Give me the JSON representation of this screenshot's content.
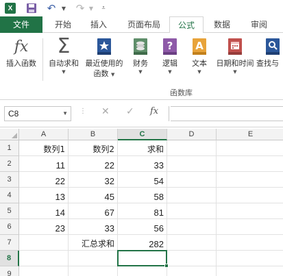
{
  "qat": {
    "logo_text": "X"
  },
  "tabs": {
    "file": "文件",
    "home": "开始",
    "insert": "插入",
    "page_layout": "页面布局",
    "formulas": "公式",
    "data": "数据",
    "review": "审阅"
  },
  "ribbon": {
    "insert_function": "插入函数",
    "autosum": "自动求和",
    "recently_used_line1": "最近使用的",
    "recently_used_line2": "函数",
    "financial": "财务",
    "logical": "逻辑",
    "text": "文本",
    "date_time": "日期和时间",
    "lookup": "查找与",
    "group_label": "函数库",
    "icons": [
      "fx-icon",
      "sigma-icon",
      "star-book-icon",
      "coins-book-icon",
      "question-book-icon",
      "text-book-icon",
      "calendar-book-icon",
      "lookup-book-icon"
    ],
    "colors": {
      "brand": "#217346",
      "blue_book": "#2b579a",
      "finance": "#5f8e6a",
      "logic": "#8e5aa8",
      "text_book": "#e8a33a",
      "date_book": "#c0504d"
    }
  },
  "formula_bar": {
    "name_box": "C8",
    "fx_label": "fx",
    "value": ""
  },
  "sheet": {
    "columns": [
      "A",
      "B",
      "C",
      "D",
      "E"
    ],
    "rows": [
      "1",
      "2",
      "3",
      "4",
      "5",
      "6",
      "7",
      "8",
      "9"
    ],
    "selected_column": "C",
    "selected_row": "8",
    "cells": {
      "A1": "数列1",
      "B1": "数列2",
      "C1": "求和",
      "A2": "11",
      "B2": "22",
      "C2": "33",
      "A3": "22",
      "B3": "32",
      "C3": "54",
      "A4": "13",
      "B4": "45",
      "C4": "58",
      "A5": "14",
      "B5": "67",
      "C5": "81",
      "A6": "23",
      "B6": "33",
      "C6": "56",
      "B7": "汇总求和",
      "C7": "282"
    }
  }
}
